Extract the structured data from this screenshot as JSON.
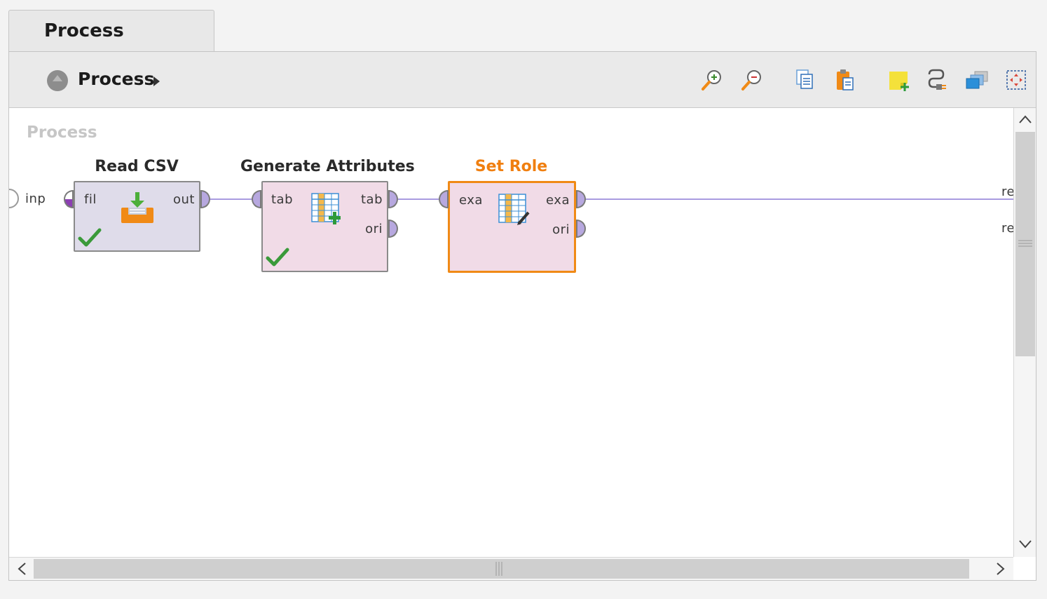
{
  "window_tab": {
    "title": "Process"
  },
  "toolbar": {
    "breadcrumb_label": "Process",
    "icons": [
      "zoom-in-icon",
      "zoom-out-icon",
      "copy-icon",
      "paste-icon",
      "add-note-icon",
      "auto-wire-icon",
      "arrange-icon",
      "fit-view-icon"
    ]
  },
  "canvas": {
    "watermark": "Process",
    "input_port_label": "inp",
    "result_port_labels": [
      "re",
      "re"
    ],
    "connection_color": "#a99be0",
    "operators": [
      {
        "name": "Read CSV",
        "in_ports": [
          "fil"
        ],
        "out_ports": [
          "out"
        ],
        "status": "ok"
      },
      {
        "name": "Generate Attributes",
        "in_ports": [
          "tab"
        ],
        "out_ports": [
          "tab",
          "ori"
        ],
        "status": "ok"
      },
      {
        "name": "Set Role",
        "in_ports": [
          "exa"
        ],
        "out_ports": [
          "exa",
          "ori"
        ],
        "selected": true
      }
    ]
  },
  "colors": {
    "selected_accent": "#f08a16",
    "read_operator_bg": "#dfdcea",
    "transform_operator_bg": "#f1dbe7",
    "port_fill": "#b7a8df"
  }
}
